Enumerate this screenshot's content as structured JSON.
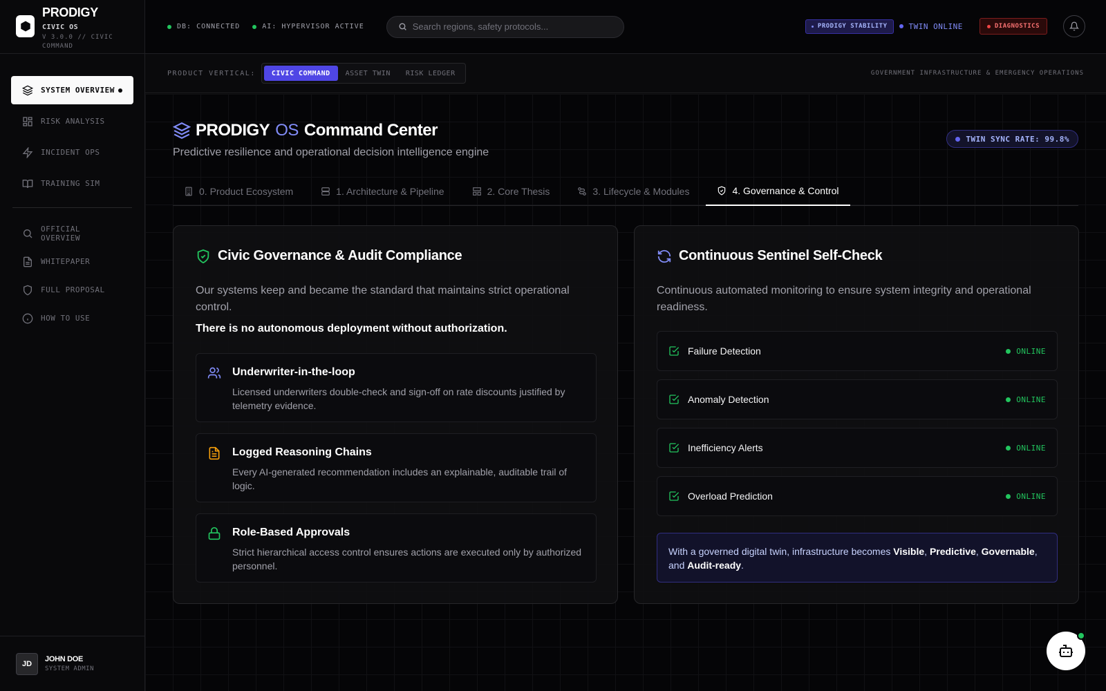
{
  "brand": {
    "name": "PRODIGY",
    "sub": "CIVIC OS",
    "version": "V 3.0.0 // CIVIC COMMAND"
  },
  "sidebar": {
    "primary": [
      {
        "label": "SYSTEM OVERVIEW",
        "icon": "layers-icon",
        "active": true
      },
      {
        "label": "RISK ANALYSIS",
        "icon": "grid-icon"
      },
      {
        "label": "INCIDENT OPS",
        "icon": "bolt-icon"
      },
      {
        "label": "TRAINING SIM",
        "icon": "book-icon"
      }
    ],
    "secondary": [
      {
        "label": "OFFICIAL OVERVIEW",
        "icon": "search-icon"
      },
      {
        "label": "WHITEPAPER",
        "icon": "document-icon"
      },
      {
        "label": "FULL PROPOSAL",
        "icon": "shield-icon"
      },
      {
        "label": "HOW TO USE",
        "icon": "info-icon"
      }
    ]
  },
  "user": {
    "initials": "JD",
    "name": "JOHN DOE",
    "role": "SYSTEM ADMIN"
  },
  "topbar": {
    "db_status": "DB: CONNECTED",
    "ai_status": "AI: HYPERVISOR ACTIVE",
    "search_placeholder": "Search regions, safety protocols...",
    "stability_badge": "PRODIGY STABILITY",
    "twin_status": "TWIN ONLINE",
    "diagnostics": "DIAGNOSTICS"
  },
  "product_vertical": {
    "label": "PRODUCT VERTICAL:",
    "options": [
      "CIVIC COMMAND",
      "ASSET TWIN",
      "RISK LEDGER"
    ],
    "selected": "CIVIC COMMAND",
    "description": "GOVERNMENT INFRASTRUCTURE & EMERGENCY OPERATIONS"
  },
  "hero": {
    "title_a": "PRODIGY",
    "title_b": "OS",
    "title_c": "Command Center",
    "subtitle": "Predictive resilience and operational decision intelligence engine",
    "sync_rate": "TWIN SYNC RATE: 99.8%"
  },
  "tabs": [
    {
      "label": "0. Product Ecosystem",
      "icon": "building-icon"
    },
    {
      "label": "1. Architecture & Pipeline",
      "icon": "server-icon"
    },
    {
      "label": "2. Core Thesis",
      "icon": "layout-icon"
    },
    {
      "label": "3. Lifecycle & Modules",
      "icon": "route-icon"
    },
    {
      "label": "4. Governance & Control",
      "icon": "shield-check-icon",
      "active": true
    }
  ],
  "governance": {
    "title": "Civic Governance & Audit Compliance",
    "description": "Our systems keep and became the standard that maintains strict operational control.",
    "emphasis": "There is no autonomous deployment without authorization.",
    "features": [
      {
        "title": "Underwriter-in-the-loop",
        "desc": "Licensed underwriters double-check and sign-off on rate discounts justified by telemetry evidence.",
        "icon": "users-icon",
        "color": "#818cf8"
      },
      {
        "title": "Logged Reasoning Chains",
        "desc": "Every AI-generated recommendation includes an explainable, auditable trail of logic.",
        "icon": "file-text-icon",
        "color": "#f59e0b"
      },
      {
        "title": "Role-Based Approvals",
        "desc": "Strict hierarchical access control ensures actions are executed only by authorized personnel.",
        "icon": "lock-icon",
        "color": "#22c55e"
      }
    ]
  },
  "sentinel": {
    "title": "Continuous Sentinel Self-Check",
    "description": "Continuous automated monitoring to ensure system integrity and operational readiness.",
    "checks": [
      {
        "label": "Failure Detection",
        "status": "ONLINE"
      },
      {
        "label": "Anomaly Detection",
        "status": "ONLINE"
      },
      {
        "label": "Inefficiency Alerts",
        "status": "ONLINE"
      },
      {
        "label": "Overload Prediction",
        "status": "ONLINE"
      }
    ],
    "note_prefix": "With a governed digital twin, infrastructure becomes ",
    "note_w1": "Visible",
    "note_w2": "Predictive",
    "note_w3": "Governable",
    "note_w4": "Audit-ready",
    "note_sep": ", ",
    "note_and": ", and ",
    "note_end": "."
  },
  "colors": {
    "accent": "#4f46e5",
    "online": "#22c55e",
    "alert": "#ef4444"
  }
}
